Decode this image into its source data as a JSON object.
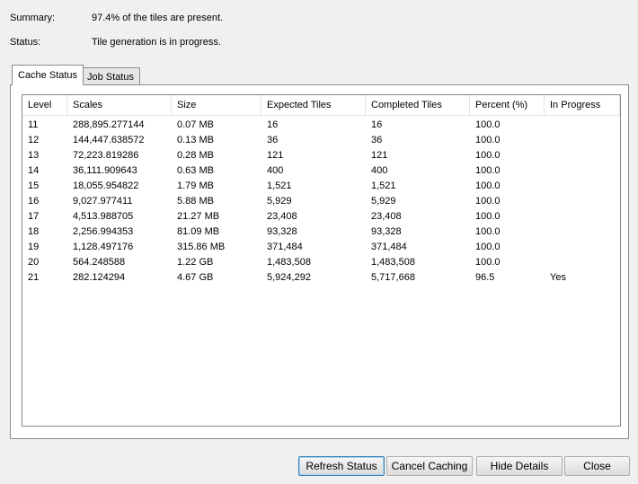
{
  "summary": {
    "label": "Summary:",
    "value": "97.4% of the tiles are present."
  },
  "status": {
    "label": "Status:",
    "value": "Tile generation is in progress."
  },
  "tabs": [
    {
      "label": "Cache Status",
      "active": true
    },
    {
      "label": "Job Status",
      "active": false
    }
  ],
  "table": {
    "columns": [
      "Level",
      "Scales",
      "Size",
      "Expected Tiles",
      "Completed Tiles",
      "Percent (%)",
      "In Progress"
    ],
    "rows": [
      [
        "11",
        "288,895.277144",
        "0.07 MB",
        "16",
        "16",
        "100.0",
        ""
      ],
      [
        "12",
        "144,447.638572",
        "0.13 MB",
        "36",
        "36",
        "100.0",
        ""
      ],
      [
        "13",
        "72,223.819286",
        "0.28 MB",
        "121",
        "121",
        "100.0",
        ""
      ],
      [
        "14",
        "36,111.909643",
        "0.63 MB",
        "400",
        "400",
        "100.0",
        ""
      ],
      [
        "15",
        "18,055.954822",
        "1.79 MB",
        "1,521",
        "1,521",
        "100.0",
        ""
      ],
      [
        "16",
        "9,027.977411",
        "5.88 MB",
        "5,929",
        "5,929",
        "100.0",
        ""
      ],
      [
        "17",
        "4,513.988705",
        "21.27 MB",
        "23,408",
        "23,408",
        "100.0",
        ""
      ],
      [
        "18",
        "2,256.994353",
        "81.09 MB",
        "93,328",
        "93,328",
        "100.0",
        ""
      ],
      [
        "19",
        "1,128.497176",
        "315.86 MB",
        "371,484",
        "371,484",
        "100.0",
        ""
      ],
      [
        "20",
        "564.248588",
        "1.22 GB",
        "1,483,508",
        "1,483,508",
        "100.0",
        ""
      ],
      [
        "21",
        "282.124294",
        "4.67 GB",
        "5,924,292",
        "5,717,668",
        "96.5",
        "Yes"
      ]
    ]
  },
  "buttons": {
    "refresh": "Refresh Status",
    "cancel": "Cancel Caching",
    "hide": "Hide Details",
    "close": "Close"
  }
}
